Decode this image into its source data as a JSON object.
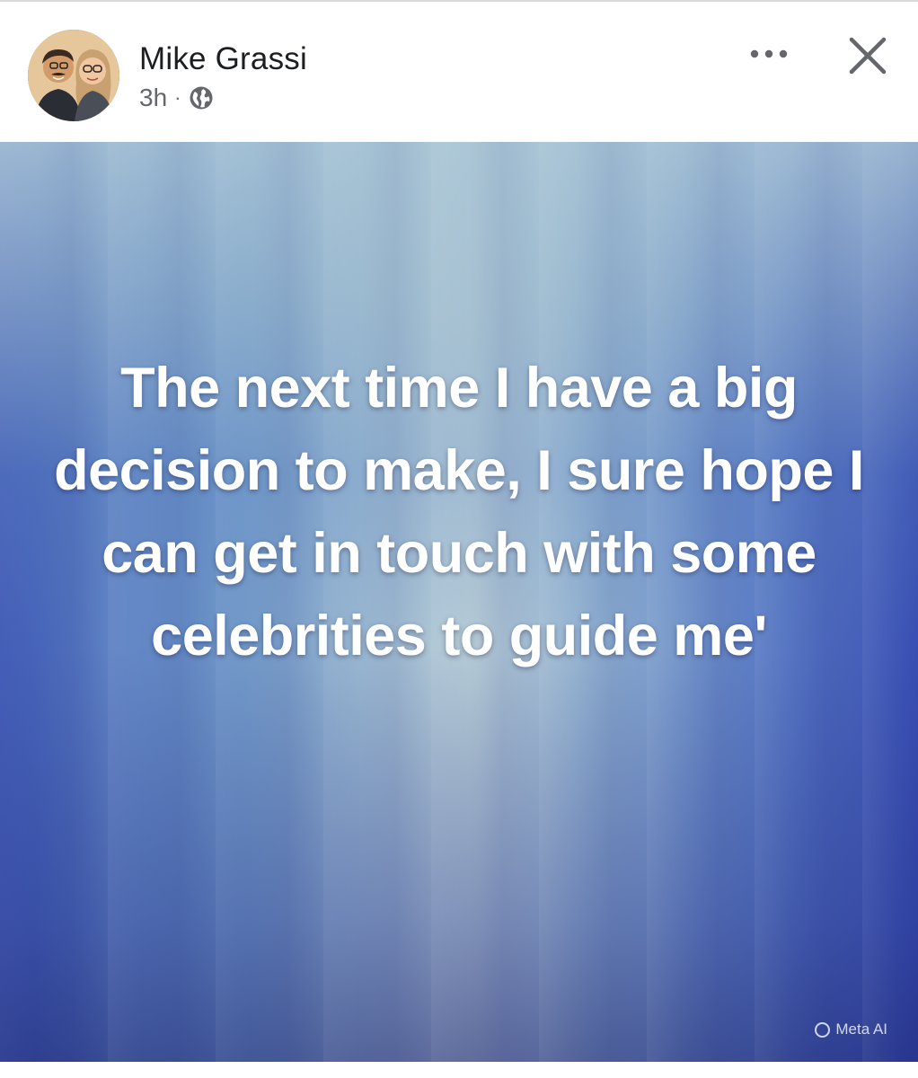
{
  "post": {
    "author": "Mike Grassi",
    "time_ago": "3h",
    "separator": "·",
    "audience_icon": "globe-icon",
    "more_icon": "more-options-icon",
    "close_icon": "close-icon",
    "text": "The next time I have a big decision to make, I sure hope I can get in touch with some celebrities to guide me'",
    "watermark": "Meta AI",
    "background_colors": {
      "top": "#b6cbd6",
      "mid": "#5f82c4",
      "bottom": "#1d2478"
    }
  }
}
